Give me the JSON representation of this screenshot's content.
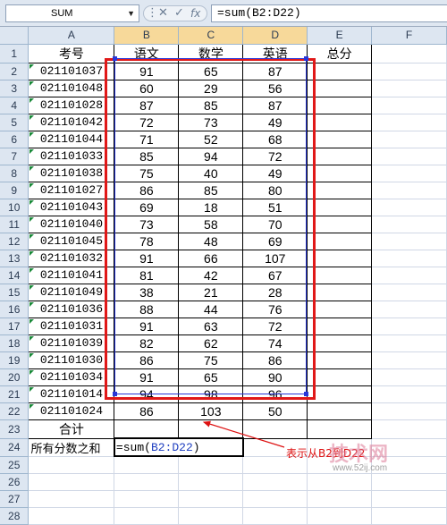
{
  "namebox": {
    "value": "SUM"
  },
  "formula_bar": {
    "content": "=sum(B2:D22)"
  },
  "columns": [
    "A",
    "B",
    "C",
    "D",
    "E",
    "F"
  ],
  "row_numbers": [
    "1",
    "2",
    "3",
    "4",
    "5",
    "6",
    "7",
    "8",
    "9",
    "10",
    "11",
    "12",
    "13",
    "14",
    "15",
    "16",
    "17",
    "18",
    "19",
    "20",
    "21",
    "22",
    "23",
    "24",
    "25",
    "26",
    "27",
    "28"
  ],
  "header_row": [
    "考号",
    "语文",
    "数学",
    "英语",
    "总分"
  ],
  "rows": [
    [
      "021101037",
      "91",
      "65",
      "87"
    ],
    [
      "021101048",
      "60",
      "29",
      "56"
    ],
    [
      "021101028",
      "87",
      "85",
      "87"
    ],
    [
      "021101042",
      "72",
      "73",
      "49"
    ],
    [
      "021101044",
      "71",
      "52",
      "68"
    ],
    [
      "021101033",
      "85",
      "94",
      "72"
    ],
    [
      "021101038",
      "75",
      "40",
      "49"
    ],
    [
      "021101027",
      "86",
      "85",
      "80"
    ],
    [
      "021101043",
      "69",
      "18",
      "51"
    ],
    [
      "021101040",
      "73",
      "58",
      "70"
    ],
    [
      "021101045",
      "78",
      "48",
      "69"
    ],
    [
      "021101032",
      "91",
      "66",
      "107"
    ],
    [
      "021101041",
      "81",
      "42",
      "67"
    ],
    [
      "021101049",
      "38",
      "21",
      "28"
    ],
    [
      "021101036",
      "88",
      "44",
      "76"
    ],
    [
      "021101031",
      "91",
      "63",
      "72"
    ],
    [
      "021101039",
      "82",
      "62",
      "74"
    ],
    [
      "021101030",
      "86",
      "75",
      "86"
    ],
    [
      "021101034",
      "91",
      "65",
      "90"
    ],
    [
      "021101014",
      "94",
      "98",
      "96"
    ],
    [
      "021101024",
      "86",
      "103",
      "50"
    ]
  ],
  "total_label": "合计",
  "sum_label": "所有分数之和",
  "active_cell_formula": {
    "prefix": "=sum(",
    "ref": "B2:D22",
    "suffix": ")"
  },
  "annotation": "表示从B2到D22",
  "watermark": {
    "text": "技术网",
    "url": "www.52ij.com"
  },
  "colors": {
    "selection_border": "#e01818",
    "range_border": "#2836d8",
    "header_bg": "#dde6f1"
  }
}
